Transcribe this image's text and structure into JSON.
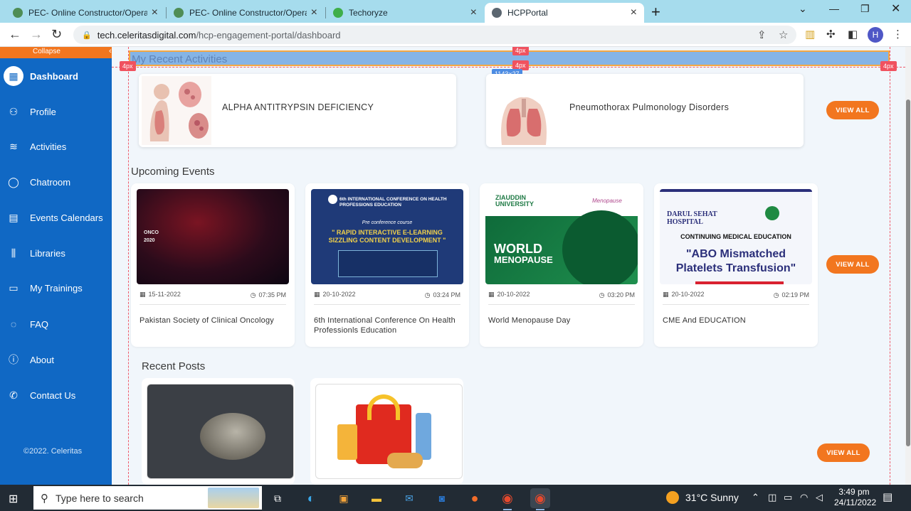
{
  "browser": {
    "tabs": [
      {
        "title": "PEC- Online Constructor/Operato",
        "favicon_color": "#4f8d55"
      },
      {
        "title": "PEC- Online Constructor/Operato",
        "favicon_color": "#4f8d55"
      },
      {
        "title": "Techoryze",
        "favicon_color": "#3fae49"
      },
      {
        "title": "HCPPortal",
        "favicon_color": "#5b6670"
      }
    ],
    "url_domain": "tech.celeritasdigital.com",
    "url_path": "/hcp-engagement-portal/dashboard",
    "profile_initial": "H"
  },
  "sidebar": {
    "collapse_label": "Collapse",
    "items": [
      {
        "label": "Dashboard",
        "icon": "dashboard-icon"
      },
      {
        "label": "Profile",
        "icon": "user-icon"
      },
      {
        "label": "Activities",
        "icon": "layers-icon"
      },
      {
        "label": "Chatroom",
        "icon": "chat-icon"
      },
      {
        "label": "Events Calendars",
        "icon": "calendar-icon"
      },
      {
        "label": "Libraries",
        "icon": "library-icon"
      },
      {
        "label": "My Trainings",
        "icon": "training-icon"
      },
      {
        "label": "FAQ",
        "icon": "faq-icon"
      },
      {
        "label": "About",
        "icon": "info-icon"
      },
      {
        "label": "Contact Us",
        "icon": "phone-icon"
      }
    ],
    "copyright": "©2022. Celeritas"
  },
  "inspector": {
    "top_margin": "4px",
    "left_margin": "4px",
    "inner_margin": "4px",
    "right_margin": "4px",
    "dimensions": "1143×27"
  },
  "activities": {
    "title": "My Recent Activities",
    "items": [
      {
        "title": "ALPHA ANTITRYPSIN DEFICIENCY"
      },
      {
        "title": "Pneumothorax Pulmonology Disorders"
      }
    ],
    "view_all": "VIEW ALL"
  },
  "events": {
    "title": "Upcoming Events",
    "items": [
      {
        "date": "15-11-2022",
        "time": "07:35 PM",
        "name": "Pakistan Society of Clinical Oncology"
      },
      {
        "date": "20-10-2022",
        "time": "03:24 PM",
        "name": "6th International Conference On Health Professionls Education"
      },
      {
        "date": "20-10-2022",
        "time": "03:20 PM",
        "name": "World Menopause Day"
      },
      {
        "date": "20-10-2022",
        "time": "02:19 PM",
        "name": "CME And EDUCATION"
      }
    ],
    "view_all": "VIEW ALL"
  },
  "event_posters": {
    "onco": {
      "line1": "ONCO",
      "line2": "2020"
    },
    "conference": {
      "header": "6th INTERNATIONAL CONFERENCE ON HEALTH PROFESSIONS EDUCATION",
      "sub": "Pre conference course",
      "course": "\" RAPID INTERACTIVE E-LEARNING SIZZLING CONTENT DEVELOPMENT \""
    },
    "menopause": {
      "org": "ZIAUDDIN UNIVERSITY",
      "line1": "WORLD",
      "line2": "MENOPAUSE",
      "badge": "Menopause"
    },
    "cme": {
      "hospital": "DARUL SEHAT HOSPITAL",
      "title": "CONTINUING MEDICAL EDUCATION",
      "line1": "\"ABO Mismatched",
      "line2": "Platelets Transfusion\""
    }
  },
  "posts": {
    "title": "Recent Posts",
    "view_all": "VIEW ALL"
  },
  "taskbar": {
    "search_placeholder": "Type here to search",
    "weather": "31°C  Sunny",
    "time": "3:49 pm",
    "date": "24/11/2022"
  }
}
